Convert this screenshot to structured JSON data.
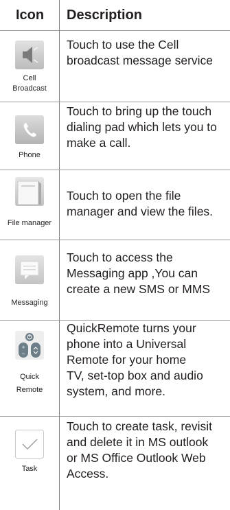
{
  "header": {
    "icon_col": "Icon",
    "desc_col": "Description"
  },
  "rows": [
    {
      "label_lines": [
        "Cell",
        "Broadcast"
      ],
      "icon": "speaker-icon",
      "desc_lines": [
        "Touch to use the Cell",
        "broadcast message service"
      ]
    },
    {
      "label_lines": [
        "Phone"
      ],
      "icon": "phone-handset-icon",
      "desc_lines": [
        "Touch to bring up the touch",
        "dialing pad which lets you to",
        "make a call."
      ]
    },
    {
      "label_lines": [
        "File manager"
      ],
      "icon": "folder-icon",
      "desc_lines": [
        "Touch to open the file",
        "manager and view the files."
      ]
    },
    {
      "label_lines": [
        "Messaging"
      ],
      "icon": "message-bubble-icon",
      "desc_lines": [
        "Touch to access the",
        "Messaging app ,You can",
        "create a new SMS or MMS"
      ]
    },
    {
      "label_lines": [
        "Quick",
        "Remote"
      ],
      "icon": "remote-control-icon",
      "desc_lines": [
        "QuickRemote turns your",
        "phone into a Universal",
        "Remote for your home",
        "TV, set-top box and audio",
        "system, and more."
      ]
    },
    {
      "label_lines": [
        "Task"
      ],
      "icon": "checkmark-icon",
      "desc_lines": [
        "Touch to create task, revisit",
        "and delete it in MS outlook",
        "or MS Office Outlook Web",
        "Access."
      ]
    }
  ]
}
